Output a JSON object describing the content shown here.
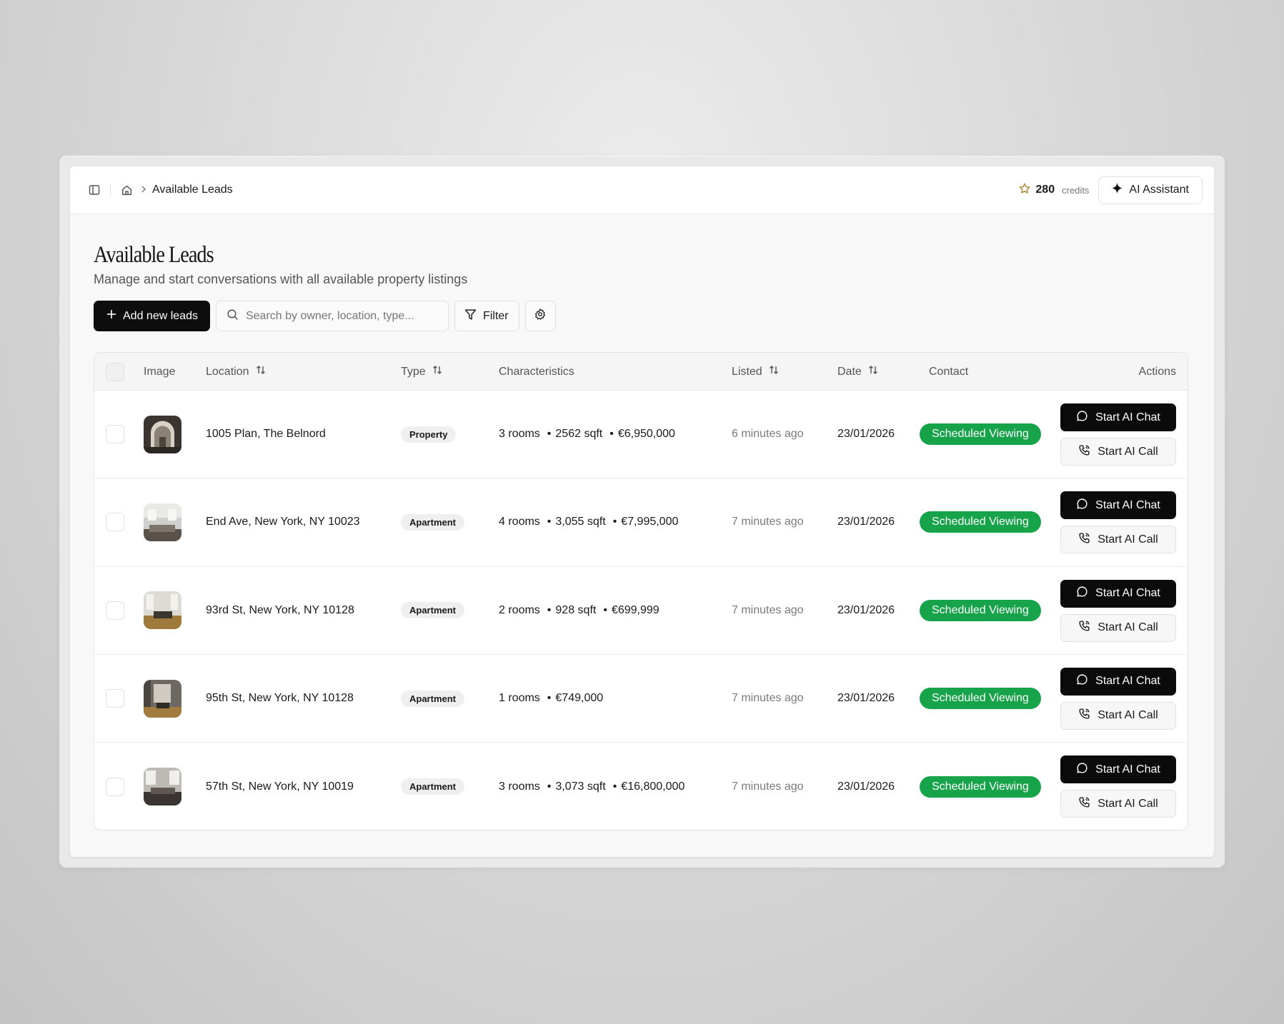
{
  "breadcrumb": {
    "label": "Available Leads"
  },
  "header": {
    "credits_value": "280",
    "credits_label": "credits",
    "ai_assistant_label": "AI Assistant"
  },
  "page": {
    "title": "Available Leads",
    "subtitle": "Manage and start conversations with all available property listings"
  },
  "toolbar": {
    "add_label": "Add new leads",
    "search_placeholder": "Search by owner, location, type...",
    "filter_label": "Filter"
  },
  "table": {
    "columns": {
      "image": "Image",
      "location": "Location",
      "type": "Type",
      "characteristics": "Characteristics",
      "listed": "Listed",
      "date": "Date",
      "contact": "Contact",
      "actions": "Actions"
    },
    "rows": [
      {
        "location": "1005 Plan, The Belnord",
        "type": "Property",
        "rooms": "3 rooms",
        "sqft": "2562 sqft",
        "price": "€6,950,000",
        "listed": "6 minutes ago",
        "date": "23/01/2026",
        "contact": "Scheduled Viewing",
        "chat_label": "Start AI Chat",
        "call_label": "Start AI Call"
      },
      {
        "location": "End Ave, New York, NY 10023",
        "type": "Apartment",
        "rooms": "4 rooms",
        "sqft": "3,055 sqft",
        "price": "€7,995,000",
        "listed": "7 minutes ago",
        "date": "23/01/2026",
        "contact": "Scheduled Viewing",
        "chat_label": "Start AI Chat",
        "call_label": "Start AI Call"
      },
      {
        "location": "93rd St, New York, NY 10128",
        "type": "Apartment",
        "rooms": "2 rooms",
        "sqft": "928 sqft",
        "price": "€699,999",
        "listed": "7 minutes ago",
        "date": "23/01/2026",
        "contact": "Scheduled Viewing",
        "chat_label": "Start AI Chat",
        "call_label": "Start AI Call"
      },
      {
        "location": "95th St, New York, NY 10128",
        "type": "Apartment",
        "rooms": "1 rooms",
        "sqft": "",
        "price": "€749,000",
        "listed": "7 minutes ago",
        "date": "23/01/2026",
        "contact": "Scheduled Viewing",
        "chat_label": "Start AI Chat",
        "call_label": "Start AI Call"
      },
      {
        "location": "57th St, New York, NY 10019",
        "type": "Apartment",
        "rooms": "3 rooms",
        "sqft": "3,073 sqft",
        "price": "€16,800,000",
        "listed": "7 minutes ago",
        "date": "23/01/2026",
        "contact": "Scheduled Viewing",
        "chat_label": "Start AI Chat",
        "call_label": "Start AI Call"
      }
    ]
  },
  "colors": {
    "status_green": "#16a34a",
    "primary_black": "#0d0d0d"
  }
}
